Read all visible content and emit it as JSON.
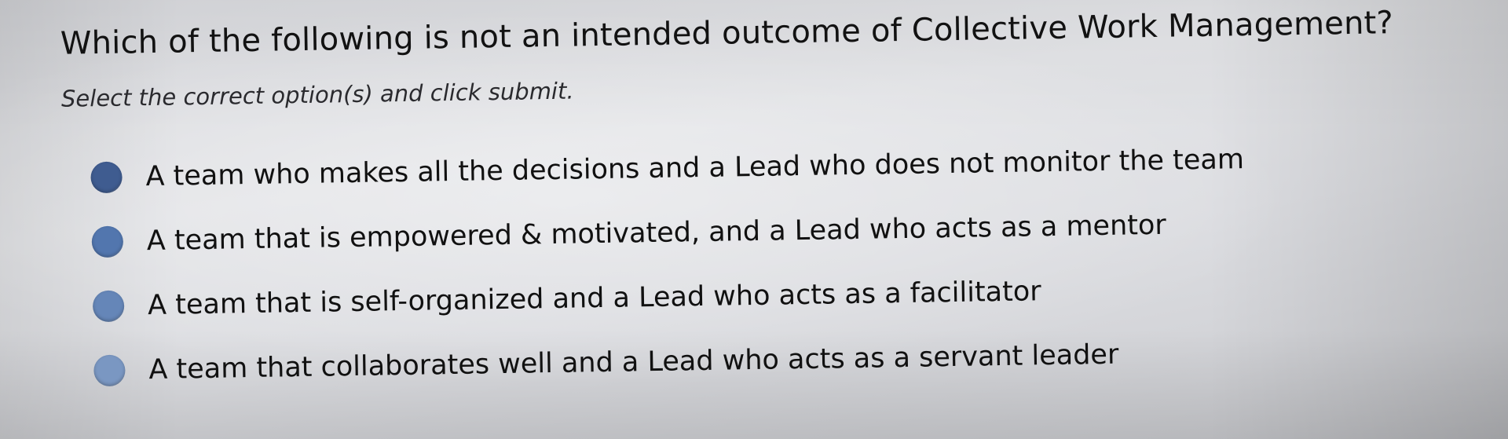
{
  "question": {
    "text": "Which of the following is not an intended outcome of Collective Work Management?",
    "instruction": "Select the correct option(s) and click submit."
  },
  "options": [
    {
      "label": "A team who makes all the decisions and a Lead who does not monitor the team",
      "radio_color": "#3f5c90",
      "selected": false
    },
    {
      "label": "A team that is empowered & motivated, and a Lead who acts as a mentor",
      "radio_color": "#5276ae",
      "selected": false
    },
    {
      "label": "A team that is self-organized and a Lead who acts as a facilitator",
      "radio_color": "#6586b8",
      "selected": false
    },
    {
      "label": "A team that collaborates well and a Lead who acts as a servant leader",
      "radio_color": "#7a97c2",
      "selected": false
    }
  ]
}
